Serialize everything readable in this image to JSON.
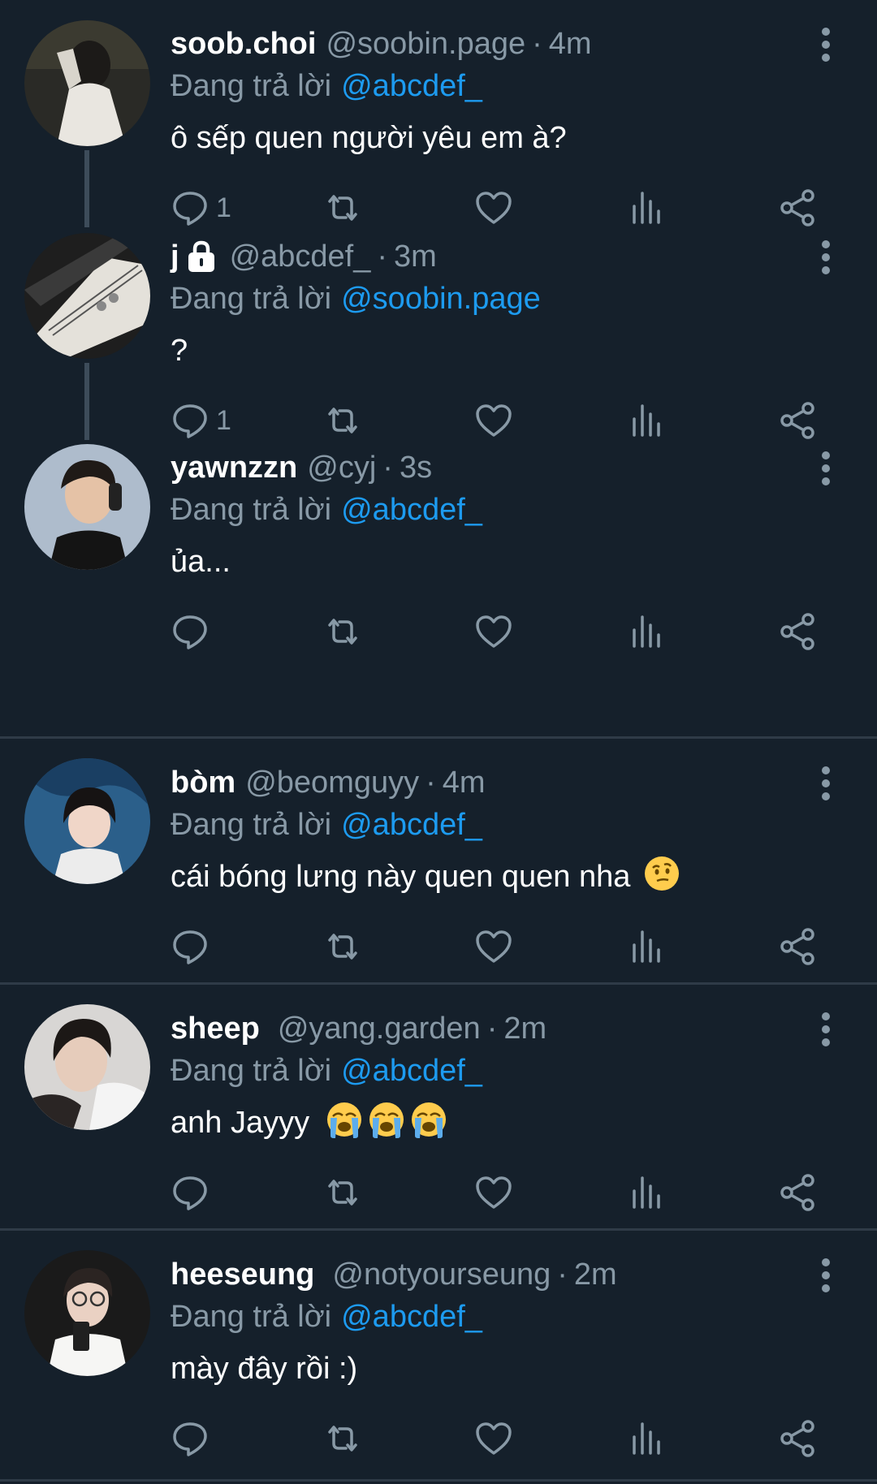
{
  "replying_label": "Đang trả lời",
  "tweets": [
    {
      "name": "soob.choi",
      "handle": "@soobin.page",
      "dot": "·",
      "time": "4m",
      "reply_to": "@abcdef_",
      "text": "ô sếp quen người yêu em à?",
      "reply_count": "1",
      "locked": false
    },
    {
      "name": "j",
      "handle": "@abcdef_",
      "dot": "·",
      "time": "3m",
      "reply_to": "@soobin.page",
      "text": "?",
      "reply_count": "1",
      "locked": true
    },
    {
      "name": "yawnzzn",
      "handle": "@cyj",
      "dot": "·",
      "time": "3s",
      "reply_to": "@abcdef_",
      "text": "ủa...",
      "reply_count": "",
      "locked": false
    },
    {
      "name": "bòm",
      "handle": "@beomguyy",
      "dot": "·",
      "time": "4m",
      "reply_to": "@abcdef_",
      "text": "cái bóng lưng này quen quen nha",
      "reply_count": "",
      "locked": false,
      "emoji": [
        "thinking-face"
      ]
    },
    {
      "name": "sheep",
      "handle": "@yang.garden",
      "dot": "·",
      "time": "2m",
      "reply_to": "@abcdef_",
      "text": "anh Jayyy",
      "reply_count": "",
      "locked": false,
      "emoji": [
        "loudly-crying-face",
        "loudly-crying-face",
        "loudly-crying-face"
      ]
    },
    {
      "name": "heeseung",
      "handle": "@notyourseung",
      "dot": "·",
      "time": "2m",
      "reply_to": "@abcdef_",
      "text": "mày đây rồi :)",
      "reply_count": "",
      "locked": false
    }
  ],
  "colors": {
    "background": "#15202b",
    "text_primary": "#ffffff",
    "text_secondary": "#8899a6",
    "link": "#1d9bf0",
    "divider": "#2f3b47",
    "thread_line": "#3d4c5a"
  },
  "icons": {
    "reply": "speech-bubble-icon",
    "retweet": "retweet-icon",
    "like": "heart-icon",
    "views": "bar-chart-icon",
    "share": "share-nodes-icon",
    "more": "vertical-dots-icon",
    "lock": "padlock-icon"
  }
}
